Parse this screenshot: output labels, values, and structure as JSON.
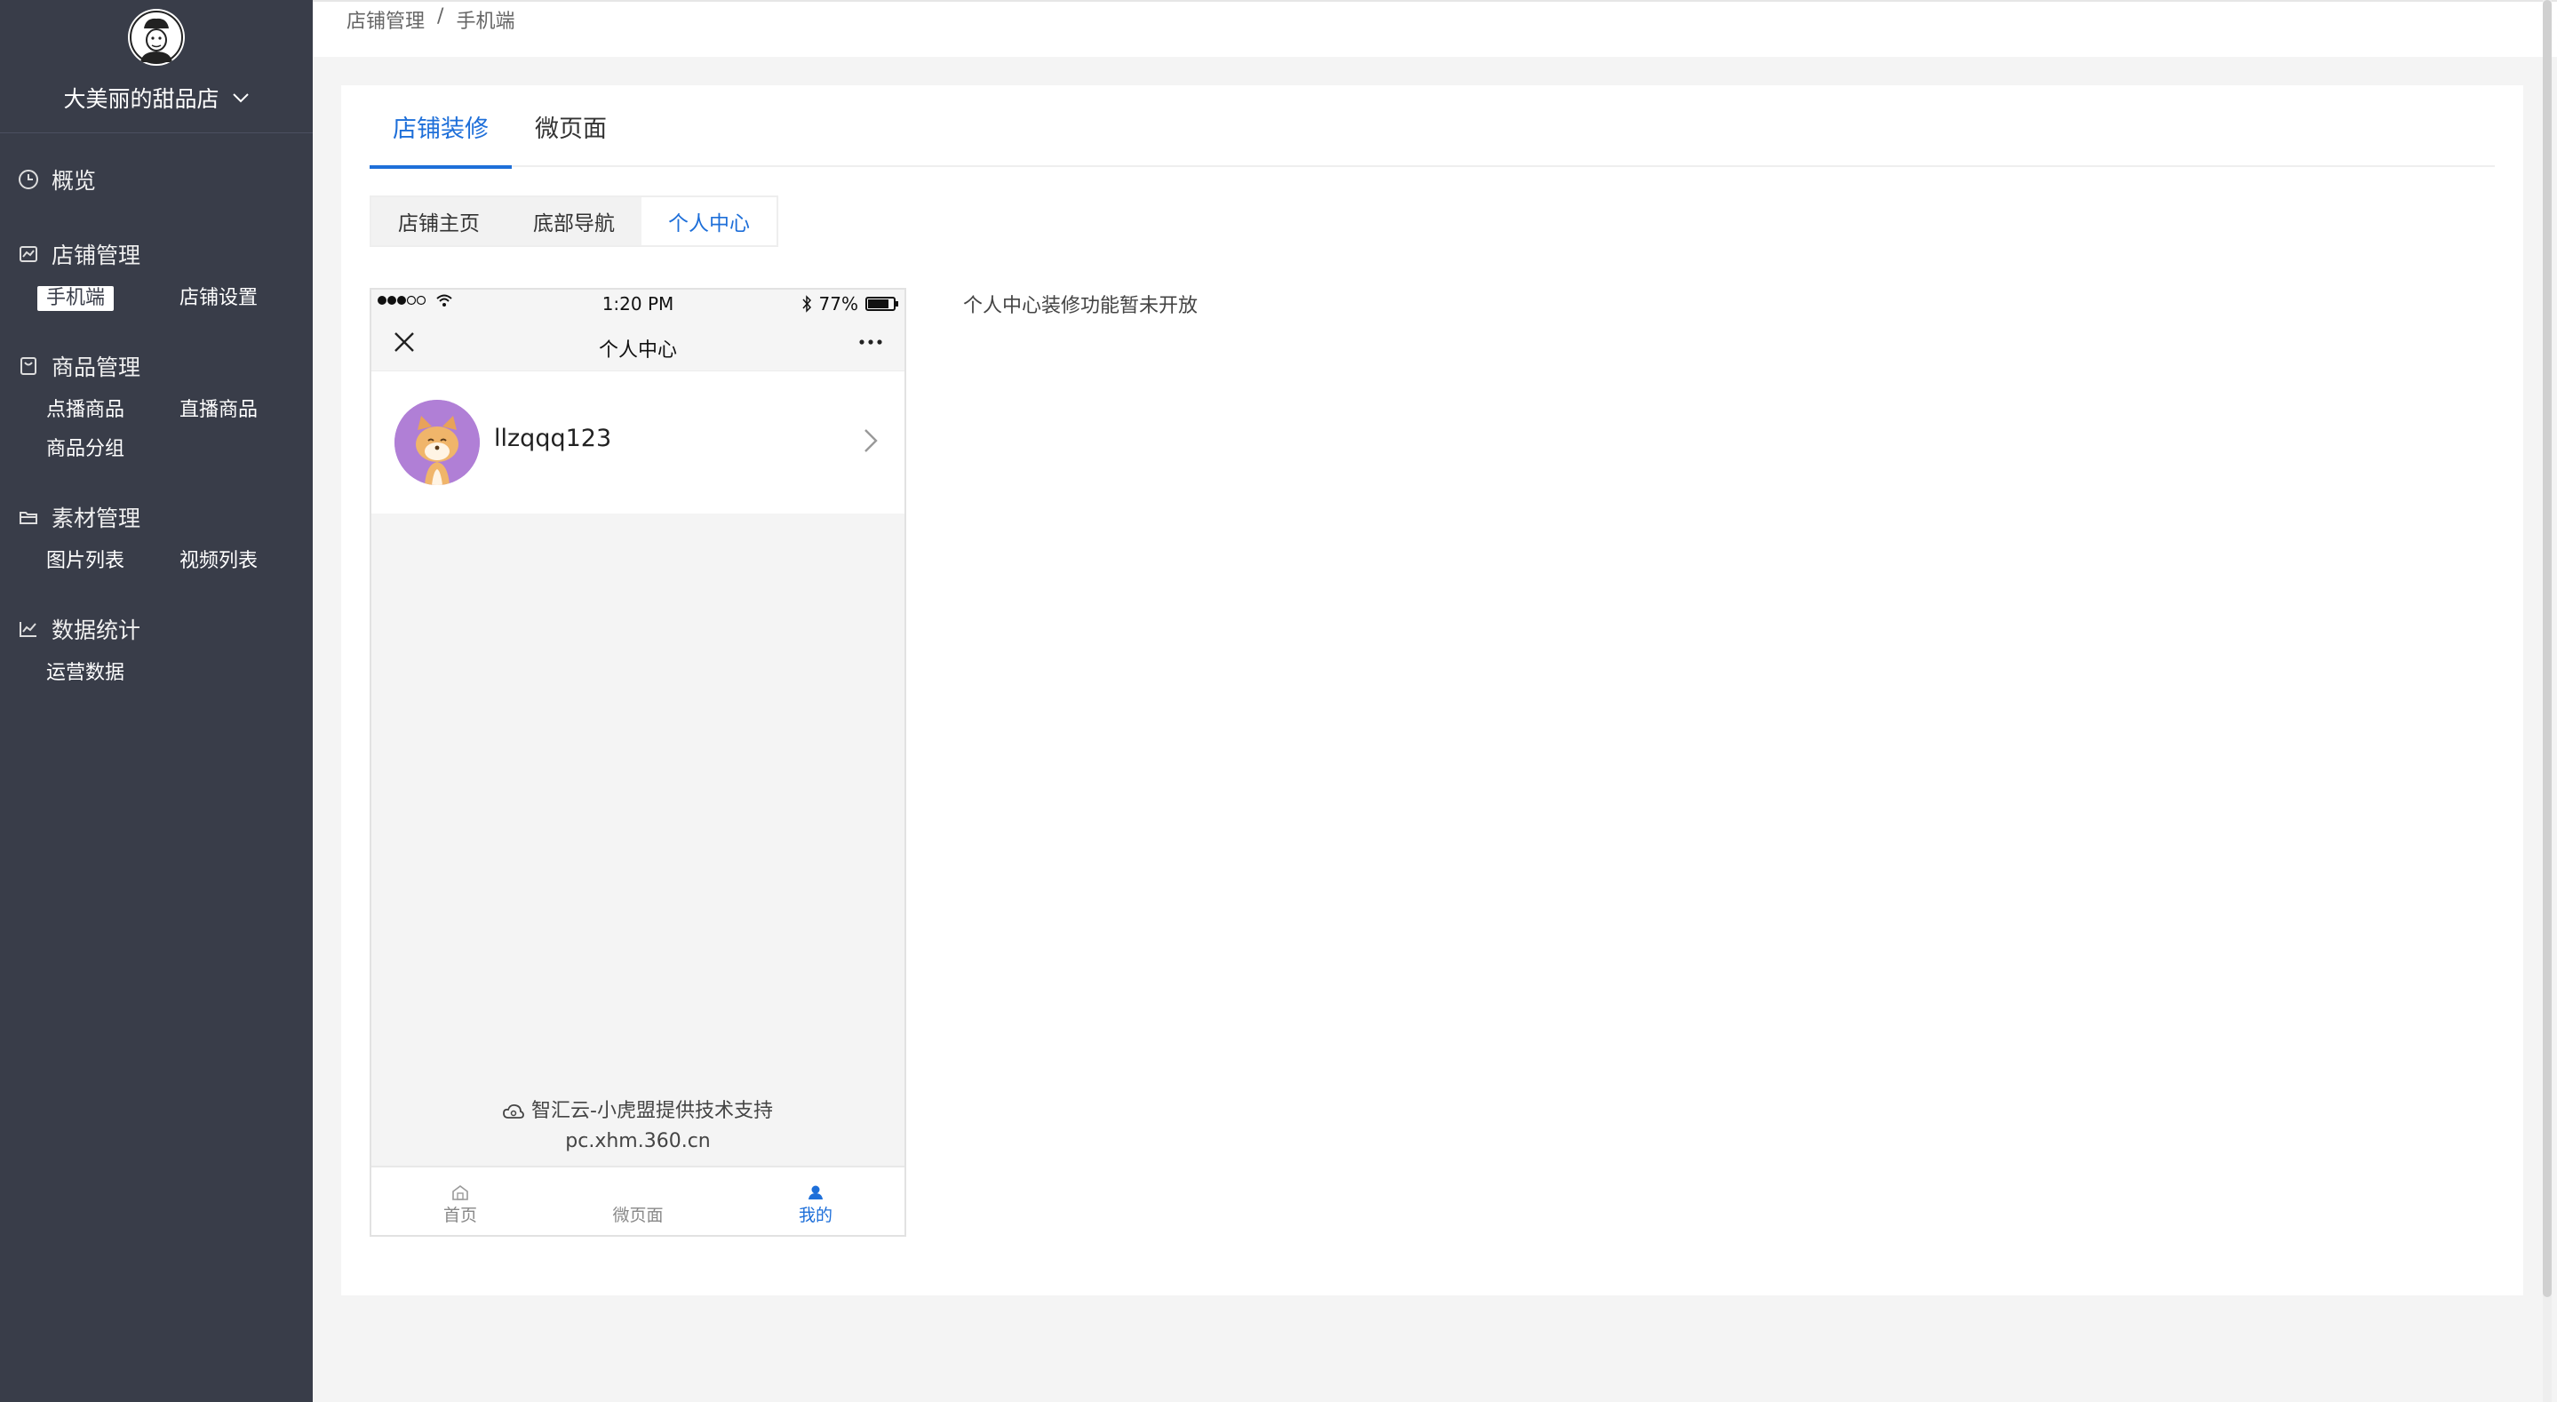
{
  "sidebar": {
    "shop_name": "大美丽的甜品店",
    "groups": [
      {
        "title": "概览",
        "icon": "clock-icon",
        "items": []
      },
      {
        "title": "店铺管理",
        "icon": "shop-icon",
        "items": [
          {
            "label": "手机端",
            "active": true
          },
          {
            "label": "店铺设置",
            "active": false
          }
        ]
      },
      {
        "title": "商品管理",
        "icon": "goods-icon",
        "items": [
          {
            "label": "点播商品",
            "active": false
          },
          {
            "label": "直播商品",
            "active": false
          },
          {
            "label": "商品分组",
            "active": false
          }
        ]
      },
      {
        "title": "素材管理",
        "icon": "folder-icon",
        "items": [
          {
            "label": "图片列表",
            "active": false
          },
          {
            "label": "视频列表",
            "active": false
          }
        ]
      },
      {
        "title": "数据统计",
        "icon": "chart-icon",
        "items": [
          {
            "label": "运营数据",
            "active": false
          }
        ]
      }
    ]
  },
  "breadcrumb": {
    "parent": "店铺管理",
    "separator": "/",
    "current": "手机端"
  },
  "tabs": [
    {
      "label": "店铺装修",
      "active": true
    },
    {
      "label": "微页面",
      "active": false
    }
  ],
  "subtabs": [
    {
      "label": "店铺主页",
      "active": false
    },
    {
      "label": "底部导航",
      "active": false
    },
    {
      "label": "个人中心",
      "active": true
    }
  ],
  "phone": {
    "status": {
      "time": "1:20 PM",
      "battery": "77%",
      "battery_level": 0.77
    },
    "title": "个人中心",
    "username": "llzqqq123",
    "footer_line1": "智汇云-小虎盟提供技术支持",
    "footer_line2": "pc.xhm.360.cn",
    "tabbar": [
      {
        "label": "首页",
        "icon": "home-icon",
        "active": false
      },
      {
        "label": "微页面",
        "icon": "",
        "active": false
      },
      {
        "label": "我的",
        "icon": "user-icon",
        "active": true
      }
    ]
  },
  "notice": "个人中心装修功能暂未开放",
  "colors": {
    "sidebar_bg": "#393d49",
    "accent": "#1e6fd9",
    "avatar_bg": "#b07fd6"
  }
}
